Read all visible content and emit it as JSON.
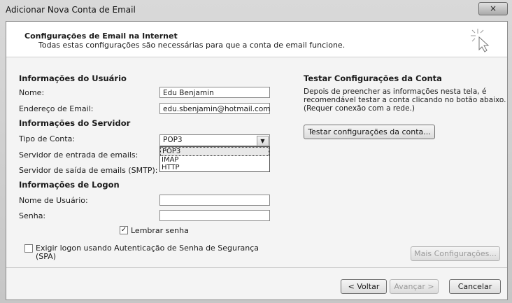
{
  "window": {
    "title": "Adicionar Nova Conta de Email",
    "close_glyph": "×"
  },
  "header": {
    "title": "Configurações de Email na Internet",
    "subtitle": "Todas estas configurações são necessárias para que a conta de email funcione.",
    "icon": "cursor-click-icon"
  },
  "user": {
    "section": "Informações do Usuário",
    "name_label": "Nome:",
    "name_value": "Edu Benjamin",
    "email_label": "Endereço de Email:",
    "email_value": "edu.sbenjamin@hotmail.com"
  },
  "server": {
    "section": "Informações do Servidor",
    "type_label": "Tipo de Conta:",
    "type_value": "POP3",
    "type_options": [
      "POP3",
      "IMAP",
      "HTTP"
    ],
    "incoming_label": "Servidor de entrada de emails:",
    "outgoing_label": "Servidor de saída de emails (SMTP):"
  },
  "logon": {
    "section": "Informações de Logon",
    "user_label": "Nome de Usuário:",
    "password_label": "Senha:",
    "remember_label": "Lembrar senha",
    "remember_checked": true,
    "spa_label_line1": "Exigir logon usando Autenticação de Senha de Segurança",
    "spa_label_line2": "(SPA)",
    "spa_checked": false
  },
  "test": {
    "section": "Testar Configurações da Conta",
    "description": "Depois de preencher as informações nesta tela, é recomendável testar a conta clicando no botão abaixo. (Requer conexão com a rede.)",
    "button": "Testar configurações da conta..."
  },
  "buttons": {
    "more": "Mais Configurações...",
    "back": "< Voltar",
    "next": "Avançar >",
    "cancel": "Cancelar"
  }
}
